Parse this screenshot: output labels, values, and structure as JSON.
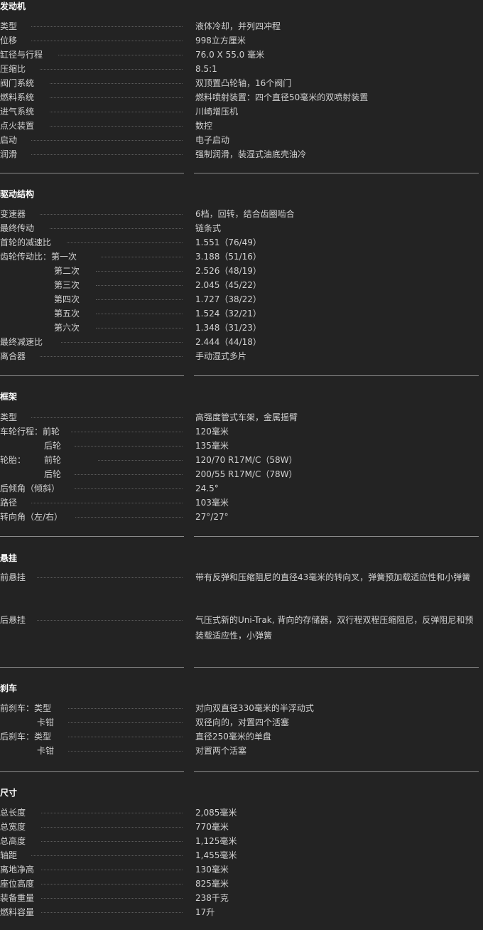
{
  "sections": [
    {
      "title": "发动机",
      "rows": [
        {
          "label": "类型",
          "value": "液体冷却，并列四冲程"
        },
        {
          "label": "位移",
          "value": "998立方厘米"
        },
        {
          "label": "缸径与行程",
          "value": "76.0 X 55.0 毫米"
        },
        {
          "label": "压缩比",
          "value": "8.5:1"
        },
        {
          "label": "阀门系统",
          "value": "双顶置凸轮轴，16个阀门"
        },
        {
          "label": "燃料系统",
          "value": "燃料喷射装置：四个直径50毫米的双喷射装置"
        },
        {
          "label": "进气系统",
          "value": "川崎增压机"
        },
        {
          "label": "点火装置",
          "value": "数控"
        },
        {
          "label": "启动",
          "value": "电子启动"
        },
        {
          "label": "润滑",
          "value": "强制润滑，装湿式油底壳油冷"
        }
      ]
    },
    {
      "title": "驱动结构",
      "rows": [
        {
          "label": "变速器",
          "value": "6档，回转，结合齿圈啮合"
        },
        {
          "label": "最终传动",
          "value": "链条式"
        },
        {
          "label": "首轮的减速比",
          "value": "1.551（76/49）"
        },
        {
          "label": "齿轮传动比：第一次",
          "value": "3.188（51/16）"
        },
        {
          "label": "第二次",
          "value": "2.526（48/19）"
        },
        {
          "label": "第三次",
          "value": "2.045（45/22）"
        },
        {
          "label": "第四次",
          "value": "1.727（38/22）"
        },
        {
          "label": "第五次",
          "value": "1.524（32/21）"
        },
        {
          "label": "第六次",
          "value": "1.348（31/23）"
        },
        {
          "label": "最终减速比",
          "value": "2.444（44/18）"
        },
        {
          "label": "离合器",
          "value": "手动湿式多片"
        }
      ]
    },
    {
      "title": "框架",
      "rows": [
        {
          "label": "类型",
          "value": "高强度管式车架，金属摇臂"
        },
        {
          "label": "车轮行程：前轮",
          "value": "120毫米"
        },
        {
          "label": "后轮",
          "value": "135毫米"
        },
        {
          "label": "轮胎：",
          "sublabel": "前轮",
          "value": "120/70 R17M/C（58W）"
        },
        {
          "label": "后轮",
          "value": "200/55 R17M/C（78W）"
        },
        {
          "label": "后倾角（倾斜）",
          "value": "24.5°"
        },
        {
          "label": "路径",
          "value": "103毫米"
        },
        {
          "label": "转向角（左/右）",
          "value": "27°/27°"
        }
      ]
    },
    {
      "title": "悬挂",
      "rows": [
        {
          "label": "前悬挂",
          "value": "带有反弹和压缩阻尼的直径43毫米的转向叉，弹簧预加载适应性和小弹簧"
        },
        {
          "label": "后悬挂",
          "value": "气压式新的Uni-Trak, 背向的存储器，双行程双程压缩阻尼，反弹阻尼和预装载适应性，小弹簧"
        }
      ]
    },
    {
      "title": "刹车",
      "rows": [
        {
          "label": "前刹车：类型",
          "value": "对向双直径330毫米的半浮动式"
        },
        {
          "label": "卡钳",
          "value": "双径向的，对置四个活塞"
        },
        {
          "label": "后刹车：类型",
          "value": "直径250毫米的单盘"
        },
        {
          "label": "卡钳",
          "value": "对置两个活塞"
        }
      ]
    },
    {
      "title": "尺寸",
      "rows": [
        {
          "label": "总长度",
          "value": "2,085毫米"
        },
        {
          "label": "总宽度",
          "value": "770毫米"
        },
        {
          "label": "总高度",
          "value": "1,125毫米"
        },
        {
          "label": "轴距",
          "value": "1,455毫米"
        },
        {
          "label": "离地净高",
          "value": "130毫米"
        },
        {
          "label": "座位高度",
          "value": "825毫米"
        },
        {
          "label": "装备重量",
          "value": "238千克"
        },
        {
          "label": "燃料容量",
          "value": "17升"
        }
      ]
    }
  ]
}
